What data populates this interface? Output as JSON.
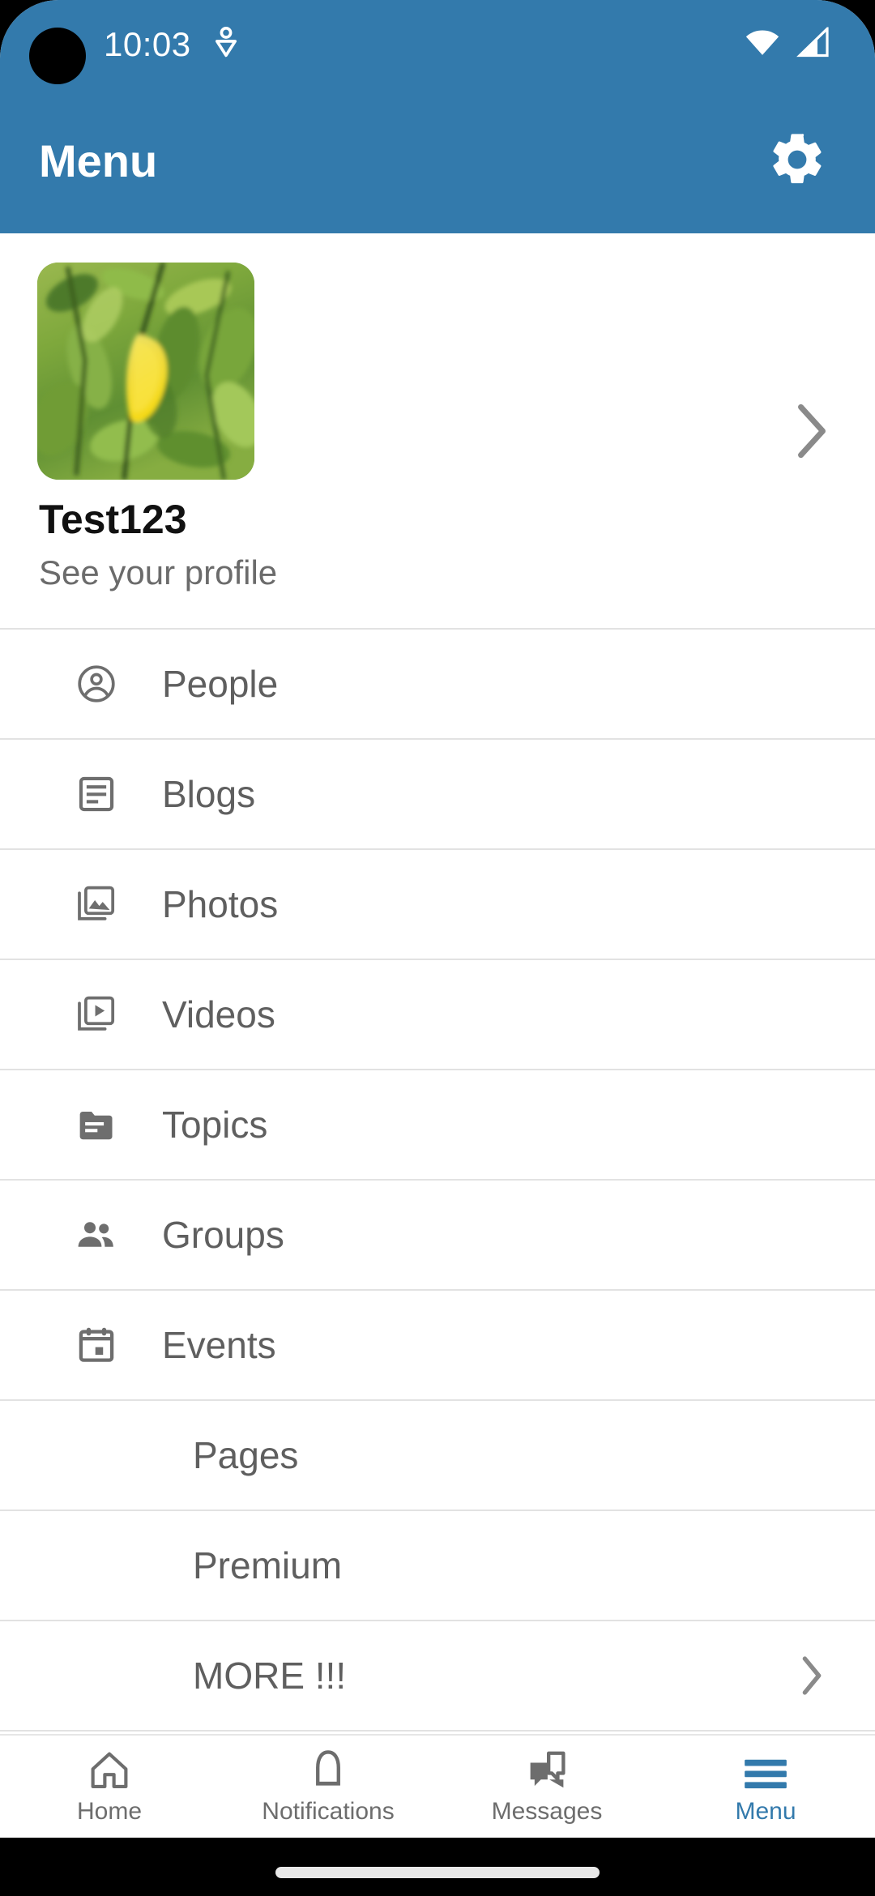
{
  "status_bar": {
    "time": "10:03",
    "icons": [
      "location-pin-icon",
      "wifi-icon",
      "cellular-signal-icon"
    ],
    "background_color": "#337aac"
  },
  "app_bar": {
    "title": "Menu",
    "settings_icon": "gear-icon",
    "background_color": "#337aac",
    "text_color": "#ffffff"
  },
  "profile": {
    "name": "Test123",
    "subtitle": "See your profile",
    "avatar_icon": "avatar-photo",
    "chevron_icon": "chevron-right-icon"
  },
  "menu": {
    "items": [
      {
        "label": "People",
        "icon": "account-circle-icon",
        "has_icon": true,
        "has_chevron": false
      },
      {
        "label": "Blogs",
        "icon": "article-icon",
        "has_icon": true,
        "has_chevron": false
      },
      {
        "label": "Photos",
        "icon": "photo-library-icon",
        "has_icon": true,
        "has_chevron": false
      },
      {
        "label": "Videos",
        "icon": "video-library-icon",
        "has_icon": true,
        "has_chevron": false
      },
      {
        "label": "Topics",
        "icon": "folder-icon",
        "has_icon": true,
        "has_chevron": false
      },
      {
        "label": "Groups",
        "icon": "people-icon",
        "has_icon": true,
        "has_chevron": false
      },
      {
        "label": "Events",
        "icon": "calendar-icon",
        "has_icon": true,
        "has_chevron": false
      },
      {
        "label": "Pages",
        "icon": "",
        "has_icon": false,
        "has_chevron": false
      },
      {
        "label": "Premium",
        "icon": "",
        "has_icon": false,
        "has_chevron": false
      },
      {
        "label": "MORE !!!",
        "icon": "",
        "has_icon": false,
        "has_chevron": true
      }
    ],
    "text_color": "#5f5f5f",
    "divider_color": "#e2e2e2"
  },
  "bottom_nav": {
    "active_color": "#337aac",
    "inactive_color": "#6d6d6d",
    "items": [
      {
        "label": "Home",
        "icon": "home-icon",
        "active": false
      },
      {
        "label": "Notifications",
        "icon": "bell-icon",
        "active": false
      },
      {
        "label": "Messages",
        "icon": "chat-bubbles-icon",
        "active": false
      },
      {
        "label": "Menu",
        "icon": "hamburger-menu-icon",
        "active": true
      }
    ]
  }
}
